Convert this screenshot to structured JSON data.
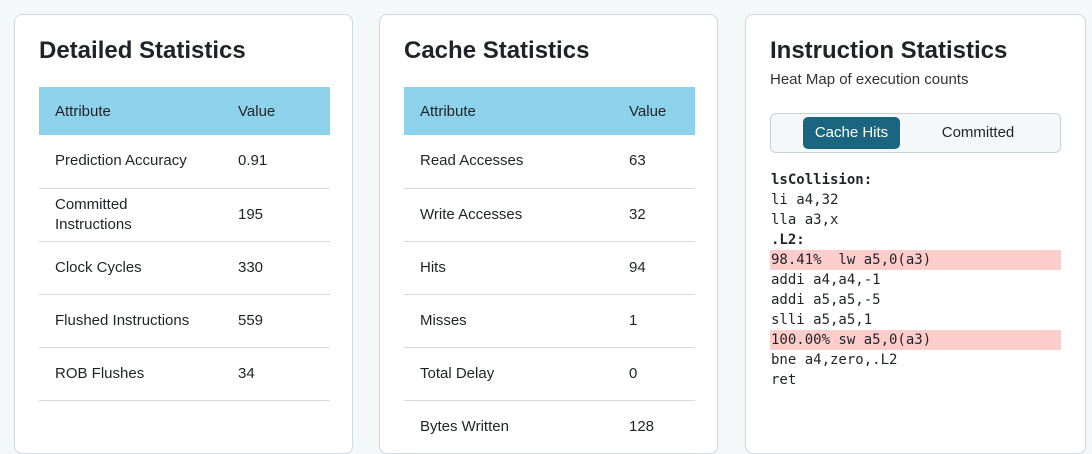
{
  "detailed": {
    "title": "Detailed Statistics",
    "headers": [
      "Attribute",
      "Value"
    ],
    "rows": [
      {
        "attr": "Prediction Accuracy",
        "value": "0.91"
      },
      {
        "attr": "Committed Instructions",
        "value": "195"
      },
      {
        "attr": "Clock Cycles",
        "value": "330"
      },
      {
        "attr": "Flushed Instructions",
        "value": "559"
      },
      {
        "attr": "ROB Flushes",
        "value": "34"
      }
    ]
  },
  "cache": {
    "title": "Cache Statistics",
    "headers": [
      "Attribute",
      "Value"
    ],
    "rows": [
      {
        "attr": "Read Accesses",
        "value": "63"
      },
      {
        "attr": "Write Accesses",
        "value": "32"
      },
      {
        "attr": "Hits",
        "value": "94"
      },
      {
        "attr": "Misses",
        "value": "1"
      },
      {
        "attr": "Total Delay",
        "value": "0"
      },
      {
        "attr": "Bytes Written",
        "value": "128"
      }
    ]
  },
  "instructions": {
    "title": "Instruction Statistics",
    "subtitle": "Heat Map of execution counts",
    "toggle": {
      "active": "Cache Hits",
      "inactive": "Committed"
    },
    "code": [
      {
        "text": "lsCollision:",
        "kind": "label"
      },
      {
        "text": "li a4,32",
        "kind": "normal"
      },
      {
        "text": "lla a3,x",
        "kind": "normal"
      },
      {
        "text": ".L2:",
        "kind": "label"
      },
      {
        "text": "98.41%  lw a5,0(a3)",
        "kind": "hot"
      },
      {
        "text": "addi a4,a4,-1",
        "kind": "normal"
      },
      {
        "text": "addi a5,a5,-5",
        "kind": "normal"
      },
      {
        "text": "slli a5,a5,1",
        "kind": "normal"
      },
      {
        "text": "100.00% sw a5,0(a3)",
        "kind": "hot"
      },
      {
        "text": "bne a4,zero,.L2",
        "kind": "normal"
      },
      {
        "text": "ret",
        "kind": "normal"
      }
    ],
    "heat_color": "#ffcccc"
  }
}
